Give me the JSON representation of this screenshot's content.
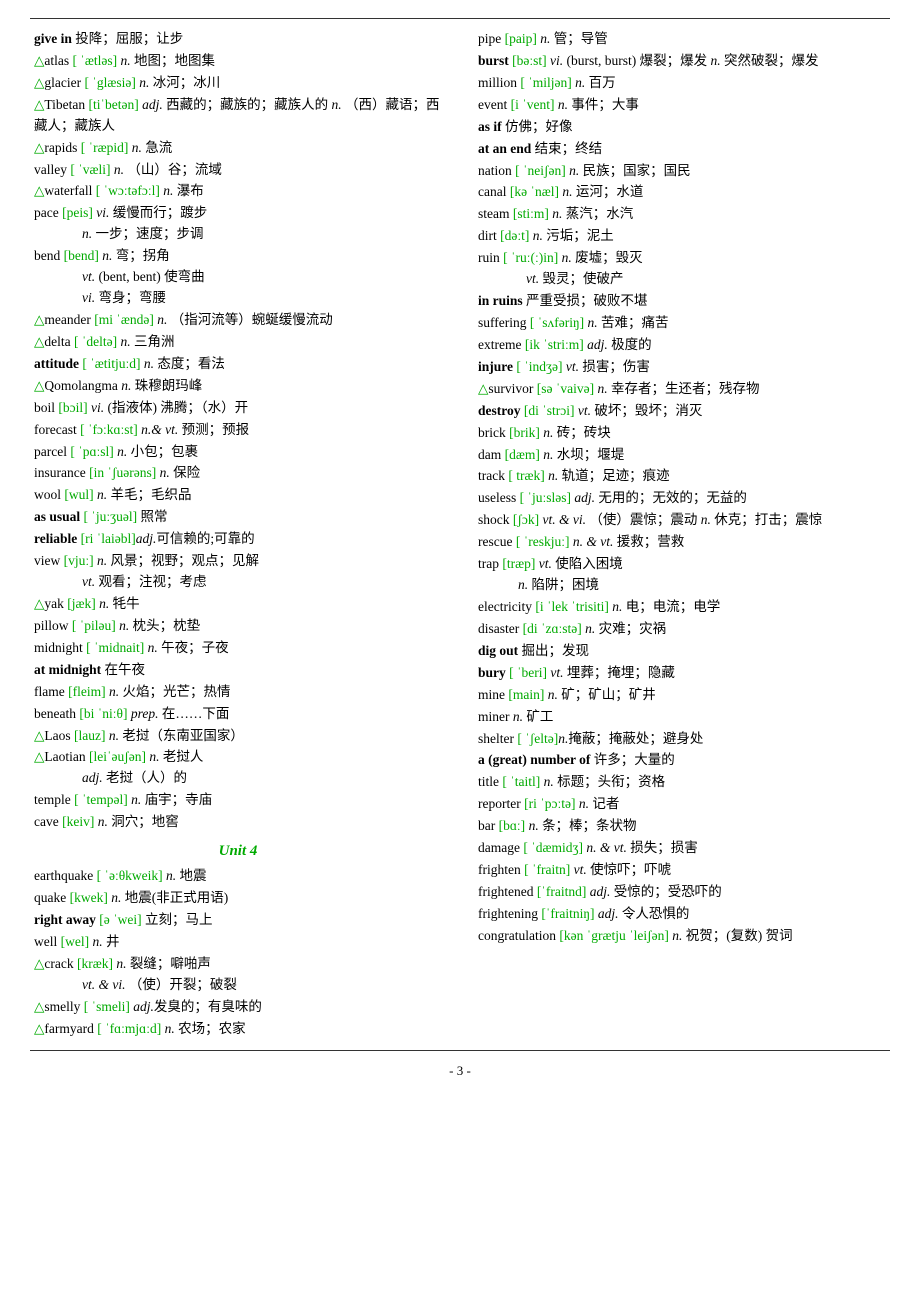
{
  "page": {
    "number": "- 3 -",
    "top_border": true,
    "bottom_border": true
  },
  "left_column": [
    {
      "type": "entry",
      "text": "<b>give in</b> 投降；屈服；让步"
    },
    {
      "type": "entry",
      "text": "<span class='triangle'>△</span>atlas <span class='phonetic'>[ ˈætlәs]</span> <i>n.</i> 地图；地图集"
    },
    {
      "type": "entry",
      "text": "<span class='triangle'>△</span>glacier <span class='phonetic'>[ ˈglæsiə]</span> <i>n.</i> 冰河；冰川"
    },
    {
      "type": "entry",
      "text": "<span class='triangle'>△</span>Tibetan <span class='phonetic'>[tiˈbetən]</span> <i>adj.</i> 西藏的；藏族的；藏族人的 <i>n.</i> （西）藏语；西藏人；藏族人"
    },
    {
      "type": "entry",
      "text": "<span class='triangle'>△</span>rapids <span class='phonetic'>[ ˈræpid]</span> <i>n.</i> 急流"
    },
    {
      "type": "entry",
      "text": "valley <span class='phonetic'>[ ˈvæli]</span> <i>n.</i> （山）谷；流域"
    },
    {
      "type": "entry",
      "text": "<span class='triangle'>△</span>waterfall <span class='phonetic'>[ ˈwɔːtəfɔːl]</span> <i>n.</i> 瀑布"
    },
    {
      "type": "entry",
      "text": "pace <span class='phonetic'>[peis]</span> <i>vi.</i> 缓慢而行；踱步<br><span style='padding-left:48px'><i>n.</i> 一步；速度；步调</span>"
    },
    {
      "type": "entry",
      "text": "bend <span class='phonetic'>[bend]</span> <i>n.</i> 弯；拐角<br><span style='padding-left:48px'><i>vt.</i> (bent, bent) 使弯曲</span><br><span style='padding-left:48px'><i>vi.</i> 弯身；弯腰</span>"
    },
    {
      "type": "entry",
      "text": "<span class='triangle'>△</span>meander <span class='phonetic'>[mi ˈændə]</span> <i>n.</i> （指河流等）蜿蜒缓慢流动"
    },
    {
      "type": "entry",
      "text": "<span class='triangle'>△</span>delta <span class='phonetic'>[ ˈdeltə]</span> <i>n.</i> 三角洲"
    },
    {
      "type": "entry",
      "text": "<b>attitude</b> <span class='phonetic'>[ ˈætitjuːd]</span> <i>n.</i> 态度；看法"
    },
    {
      "type": "entry",
      "text": "<span class='triangle'>△</span>Qomolangma <i>n.</i> 珠穆朗玛峰"
    },
    {
      "type": "entry",
      "text": "boil <span class='phonetic'>[bɔil]</span> <i>vi.</i> (指液体) 沸腾；（水）开"
    },
    {
      "type": "entry",
      "text": "forecast <span class='phonetic'>[ ˈfɔːkɑːst]</span> <i>n.& vt.</i> 预测；预报"
    },
    {
      "type": "entry",
      "text": "parcel <span class='phonetic'>[ ˈpɑːsl]</span> <i>n.</i> 小包；包裹"
    },
    {
      "type": "entry",
      "text": "insurance <span class='phonetic'>[in ˈʃuərəns]</span> <i>n.</i> 保险"
    },
    {
      "type": "entry",
      "text": "wool <span class='phonetic'>[wul]</span> <i>n.</i> 羊毛；毛织品"
    },
    {
      "type": "entry",
      "text": "<b>as usual</b> <span class='phonetic'>[ ˈjuːʒuəl]</span> 照常"
    },
    {
      "type": "entry",
      "text": "<b>reliable</b> <span class='phonetic'>[ri ˈlaiəbl]</span><i>adj.</i>可信赖的;可靠的"
    },
    {
      "type": "entry",
      "text": "view <span class='phonetic'>[vjuː]</span> <i>n.</i> 风景；视野；观点；见解<br><span style='padding-left:48px'><i>vt.</i> 观看；注视；考虑</span>"
    },
    {
      "type": "entry",
      "text": "<span class='triangle'>△</span>yak <span class='phonetic'>[jæk]</span> <i>n.</i> 牦牛"
    },
    {
      "type": "entry",
      "text": "pillow <span class='phonetic'>[ ˈpiləu]</span> <i>n.</i> 枕头；枕垫"
    },
    {
      "type": "entry",
      "text": "midnight <span class='phonetic'>[ ˈmidnait]</span> <i>n.</i> 午夜；子夜"
    },
    {
      "type": "entry",
      "text": "<b>at midnight</b> 在午夜"
    },
    {
      "type": "entry",
      "text": "flame <span class='phonetic'>[fleim]</span> <i>n.</i> 火焰；光芒；热情"
    },
    {
      "type": "entry",
      "text": "beneath <span class='phonetic'>[bi ˈniːθ]</span> <i>prep.</i> 在……下面"
    },
    {
      "type": "entry",
      "text": "<span class='triangle'>△</span>Laos <span class='phonetic'>[lauz]</span> <i>n.</i> 老挝（东南亚国家）"
    },
    {
      "type": "entry",
      "text": "<span class='triangle'>△</span>Laotian <span class='phonetic'>[leiˈəuʃən]</span> <i>n.</i> 老挝人<br><span style='padding-left:48px'><i>adj.</i> 老挝（人）的</span>"
    },
    {
      "type": "entry",
      "text": "temple <span class='phonetic'>[ ˈtempəl]</span> <i>n.</i> 庙宇；寺庙"
    },
    {
      "type": "entry",
      "text": "cave <span class='phonetic'>[keiv]</span> <i>n.</i> 洞穴；地窖"
    },
    {
      "type": "unit_header",
      "text": "Unit 4"
    },
    {
      "type": "entry",
      "text": "earthquake <span class='phonetic'>[ ˈəːθkweik]</span> <i>n.</i> 地震"
    },
    {
      "type": "entry",
      "text": "quake <span class='phonetic'>[kwek]</span> <i>n.</i> 地震(非正式用语)"
    },
    {
      "type": "entry",
      "text": "<b>right away</b> <span class='phonetic'>[ə ˈwei]</span> 立刻；马上"
    },
    {
      "type": "entry",
      "text": "well <span class='phonetic'>[wel]</span> <i>n.</i> 井"
    },
    {
      "type": "entry",
      "text": "<span class='triangle'>△</span>crack <span class='phonetic'>[kræk]</span> <i>n.</i> 裂缝；噼啪声<br><span style='padding-left:48px'><i>vt. & vi.</i> （使）开裂；破裂</span>"
    },
    {
      "type": "entry",
      "text": "<span class='triangle'>△</span>smelly <span class='phonetic'>[ ˈsmeli]</span> <i>adj.</i>发臭的；有臭味的"
    },
    {
      "type": "entry",
      "text": "<span class='triangle'>△</span>farmyard <span class='phonetic'>[ ˈfɑːmjɑːd]</span> <i>n.</i> 农场；农家"
    }
  ],
  "right_column": [
    {
      "type": "entry",
      "text": "pipe <span class='phonetic'>[paip]</span> <i>n.</i> 管；导管"
    },
    {
      "type": "entry",
      "text": "<b>burst</b> <span class='phonetic'>[bəːst]</span> <i>vi.</i> (burst, burst) 爆裂；爆发 <i>n.</i> 突然破裂；爆发"
    },
    {
      "type": "entry",
      "text": "million <span class='phonetic'>[ ˈmiljən]</span> <i>n.</i> 百万"
    },
    {
      "type": "entry",
      "text": "event <span class='phonetic'>[i ˈvent]</span> <i>n.</i> 事件；大事"
    },
    {
      "type": "entry",
      "text": "<b>as if</b> 仿佛；好像"
    },
    {
      "type": "entry",
      "text": "<b>at an end</b> 结束；终结"
    },
    {
      "type": "entry",
      "text": "nation <span class='phonetic'>[ ˈneiʃən]</span> <i>n.</i> 民族；国家；国民"
    },
    {
      "type": "entry",
      "text": "canal <span class='phonetic'>[kə ˈnæl]</span> <i>n.</i> 运河；水道"
    },
    {
      "type": "entry",
      "text": "steam <span class='phonetic'>[stiːm]</span> <i>n.</i> 蒸汽；水汽"
    },
    {
      "type": "entry",
      "text": "dirt <span class='phonetic'>[dəːt]</span> <i>n.</i> 污垢；泥土"
    },
    {
      "type": "entry",
      "text": "ruin <span class='phonetic'>[ ˈruː(ː)in]</span> <i>n.</i> 废墟；毁灭<br><span style='padding-left:48px'><i>vt.</i> 毁灭；使破产</span>"
    },
    {
      "type": "entry",
      "text": "<b>in ruins</b> 严重受损；破败不堪"
    },
    {
      "type": "entry",
      "text": "suffering <span class='phonetic'>[ ˈsʌfəriŋ]</span> <i>n.</i> 苦难；痛苦"
    },
    {
      "type": "entry",
      "text": "extreme <span class='phonetic'>[ik ˈstriːm]</span> <i>adj.</i> 极度的"
    },
    {
      "type": "entry",
      "text": "<b>injure</b> <span class='phonetic'>[ ˈindʒə]</span> <i>vt.</i> 损害；伤害"
    },
    {
      "type": "entry",
      "text": "<span class='triangle'>△</span>survivor <span class='phonetic'>[sə ˈvaivə]</span> <i>n.</i> 幸存者；生还者；残存物"
    },
    {
      "type": "entry",
      "text": "<b>destroy</b> <span class='phonetic'>[di ˈstrɔi]</span> <i>vt.</i> 破坏；毁坏；消灭"
    },
    {
      "type": "entry",
      "text": "brick <span class='phonetic'>[brik]</span> <i>n.</i> 砖；砖块"
    },
    {
      "type": "entry",
      "text": "dam <span class='phonetic'>[dæm]</span> <i>n.</i> 水坝；堰堤"
    },
    {
      "type": "entry",
      "text": "track <span class='phonetic'>[ træk]</span> <i>n.</i> 轨道；足迹；痕迹"
    },
    {
      "type": "entry",
      "text": "useless <span class='phonetic'>[ ˈjuːsləs]</span> <i>adj.</i> 无用的；无效的；无益的"
    },
    {
      "type": "entry",
      "text": "shock <span class='phonetic'>[ʃɔk]</span> <i>vt. & vi.</i> （使）震惊；震动 <i>n.</i> 休克；打击；震惊"
    },
    {
      "type": "entry",
      "text": "rescue <span class='phonetic'>[ ˈreskjuː]</span> <i>n. & vt.</i> 援救；营救"
    },
    {
      "type": "entry",
      "text": "trap <span class='phonetic'>[træp]</span> <i>vt.</i> 使陷入困境<br><span style='padding-left:40px'><i>n.</i> 陷阱；困境</span>"
    },
    {
      "type": "entry",
      "text": "electricity <span class='phonetic'>[i ˈlek ˈtrisiti]</span> <i>n.</i> 电；电流；电学"
    },
    {
      "type": "entry",
      "text": "disaster <span class='phonetic'>[di ˈzɑːstə]</span> <i>n.</i> 灾难；灾祸"
    },
    {
      "type": "entry",
      "text": "<b>dig out</b> 掘出；发现"
    },
    {
      "type": "entry",
      "text": "<b>bury</b> <span class='phonetic'>[ ˈberi]</span> <i>vt.</i> 埋葬；掩埋；隐藏"
    },
    {
      "type": "entry",
      "text": "mine <span class='phonetic'>[main]</span> <i>n.</i> 矿；矿山；矿井"
    },
    {
      "type": "entry",
      "text": "miner <i>n.</i> 矿工"
    },
    {
      "type": "entry",
      "text": "shelter <span class='phonetic'>[ ˈʃeltə]</span><i>n.</i>掩蔽；掩蔽处；避身处"
    },
    {
      "type": "entry",
      "text": "<b>a (great) number of</b> 许多；大量的"
    },
    {
      "type": "entry",
      "text": "title <span class='phonetic'>[ ˈtaitl]</span> <i>n.</i> 标题；头衔；资格"
    },
    {
      "type": "entry",
      "text": "reporter <span class='phonetic'>[ri ˈpɔːtə]</span> <i>n.</i> 记者"
    },
    {
      "type": "entry",
      "text": "bar <span class='phonetic'>[bɑː]</span> <i>n.</i> 条；棒；条状物"
    },
    {
      "type": "entry",
      "text": "damage <span class='phonetic'>[ ˈdæmidʒ]</span> <i>n. & vt.</i> 损失；损害"
    },
    {
      "type": "entry",
      "text": "frighten <span class='phonetic'>[ ˈfraitn]</span> <i>vt.</i> 使惊吓；吓唬"
    },
    {
      "type": "entry",
      "text": "frightened <span class='phonetic'>[ˈfraitnd]</span> <i>adj.</i> 受惊的；受恐吓的"
    },
    {
      "type": "entry",
      "text": "frightening <span class='phonetic'>[ˈfraitniŋ]</span> <i>adj.</i> 令人恐惧的"
    },
    {
      "type": "entry",
      "text": "congratulation <span class='phonetic'>[kən ˈgrætju ˈleiʃən]</span> <i>n.</i> 祝贺；(复数) 贺词"
    }
  ]
}
